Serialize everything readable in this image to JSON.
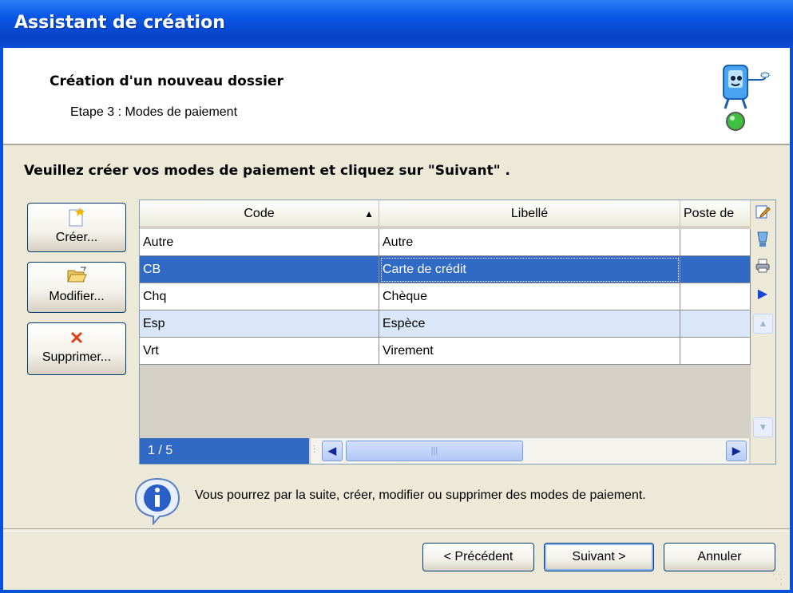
{
  "window": {
    "title": "Assistant de création"
  },
  "header": {
    "title": "Création d'un nouveau dossier",
    "subtitle": "Etape 3 : Modes de paiement",
    "icon": "wizard-computer-icon"
  },
  "instruction": "Veuillez créer vos modes de paiement et cliquez sur \"Suivant\" .",
  "side_buttons": [
    {
      "label": "Créer...",
      "icon": "new-document-icon"
    },
    {
      "label": "Modifier...",
      "icon": "open-folder-icon"
    },
    {
      "label": "Supprimer...",
      "icon": "delete-x-icon"
    }
  ],
  "grid": {
    "columns": [
      "Code",
      "Libellé",
      "Poste de"
    ],
    "sort_indicator": "▲",
    "rows": [
      {
        "code": "Autre",
        "libelle": "Autre",
        "poste": ""
      },
      {
        "code": "CB",
        "libelle": "Carte de crédit",
        "poste": ""
      },
      {
        "code": "Chq",
        "libelle": "Chèque",
        "poste": ""
      },
      {
        "code": "Esp",
        "libelle": "Espèce",
        "poste": ""
      },
      {
        "code": "Vrt",
        "libelle": "Virement",
        "poste": ""
      }
    ],
    "selected_row": 1,
    "counter": "1 / 5",
    "tools": [
      "edit-icon",
      "export-icon",
      "print-icon",
      "play-icon"
    ],
    "accent": "#316ac5"
  },
  "info": {
    "icon": "info-icon",
    "text": "Vous pourrez par la suite, créer, modifier ou supprimer des modes de paiement."
  },
  "footer": {
    "prev_label": "< Précédent",
    "next_label": "Suivant >",
    "cancel_label": "Annuler"
  }
}
